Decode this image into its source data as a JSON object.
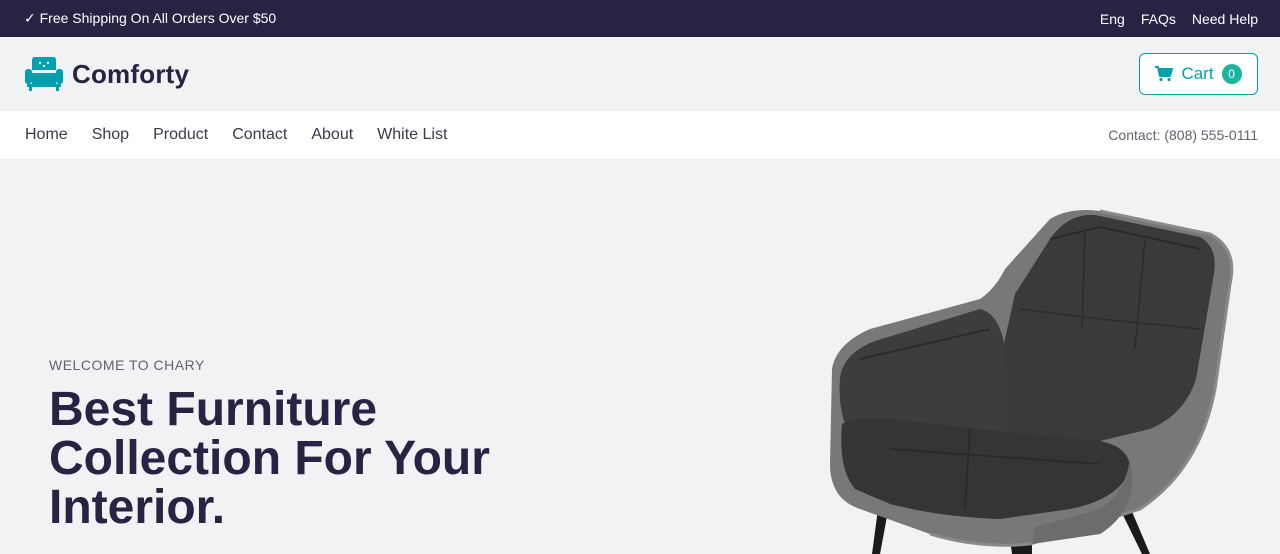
{
  "topbar": {
    "shipping_text": "✓ Free Shipping On All Orders Over $50",
    "lang": "Eng",
    "faqs": "FAQs",
    "help": "Need Help"
  },
  "header": {
    "brand": "Comforty",
    "cart_label": "Cart",
    "cart_count": "0"
  },
  "nav": {
    "items": [
      "Home",
      "Shop",
      "Product",
      "Contact",
      "About",
      "White List"
    ],
    "contact_label": "Contact:",
    "contact_phone": "(808) 555-0111"
  },
  "hero": {
    "welcome": "WELCOME TO CHARY",
    "headline_line1": "Best Furniture",
    "headline_line2": "Collection For Your",
    "headline_line3": "Interior."
  },
  "colors": {
    "topbar_bg": "#272343",
    "accent": "#029fae",
    "page_bg": "#f0f2f3"
  },
  "icons": {
    "brand": "armchair-logo-icon",
    "cart": "cart-icon",
    "hero_image": "armchair-product-image"
  }
}
